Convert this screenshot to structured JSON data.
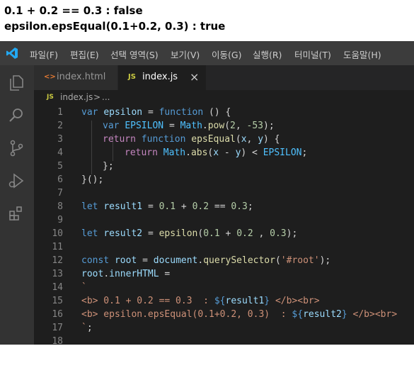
{
  "output": {
    "line1": "0.1 + 0.2 == 0.3 : false",
    "line2": "epsilon.epsEqual(0.1+0.2, 0.3) : true"
  },
  "menu": {
    "items": [
      "파일(F)",
      "편집(E)",
      "선택 영역(S)",
      "보기(V)",
      "이동(G)",
      "실행(R)",
      "터미널(T)",
      "도움말(H)"
    ]
  },
  "tabs": [
    {
      "icon": "<>",
      "label": "index.html",
      "active": false
    },
    {
      "icon": "JS",
      "label": "index.js",
      "active": true,
      "close": "×"
    }
  ],
  "breadcrumb": {
    "icon": "JS",
    "file": "index.js",
    "separator": ">",
    "more": "..."
  },
  "code_lines": [
    {
      "n": "1"
    },
    {
      "n": "2"
    },
    {
      "n": "3"
    },
    {
      "n": "4"
    },
    {
      "n": "5"
    },
    {
      "n": "6"
    },
    {
      "n": "7"
    },
    {
      "n": "8"
    },
    {
      "n": "9"
    },
    {
      "n": "10"
    },
    {
      "n": "11"
    },
    {
      "n": "12"
    },
    {
      "n": "13"
    },
    {
      "n": "14"
    },
    {
      "n": "15"
    },
    {
      "n": "16"
    },
    {
      "n": "17"
    },
    {
      "n": "18"
    }
  ],
  "code_tokens": {
    "l1": [
      "var",
      "epsilon",
      "=",
      "function",
      "() {"
    ],
    "l2": [
      "var",
      "EPSILON",
      "=",
      "Math",
      ".",
      "pow",
      "(",
      "2",
      ", ",
      "-53",
      ");"
    ],
    "l3": [
      "return",
      "function",
      "epsEqual",
      "(",
      "x",
      ", ",
      "y",
      ") {"
    ],
    "l4": [
      "return",
      "Math",
      ".",
      "abs",
      "(",
      "x",
      " - ",
      "y",
      ") < ",
      "EPSILON",
      ";"
    ],
    "l5": [
      "};"
    ],
    "l6": [
      "}();"
    ],
    "l8": [
      "let",
      "result1",
      "=",
      "0.1",
      "+",
      "0.2",
      "==",
      "0.3",
      ";"
    ],
    "l10": [
      "let",
      "result2",
      "=",
      "epsilon",
      "(",
      "0.1",
      " + ",
      "0.2",
      " , ",
      "0.3",
      ");"
    ],
    "l12": [
      "const",
      "root",
      "=",
      "document",
      ".",
      "querySelector",
      "(",
      "'#root'",
      ");"
    ],
    "l13": [
      "root",
      ".",
      "innerHTML",
      " ="
    ],
    "l14": [
      "`"
    ],
    "l15": [
      "<b> 0.1 + 0.2 == 0.3  : ",
      "${",
      "result1",
      "}",
      " </b><br>"
    ],
    "l16": [
      "<b> epsilon.epsEqual(0.1+0.2, 0.3)  : ",
      "${",
      "result2",
      "}",
      " </b><br>"
    ],
    "l17": [
      "`",
      ";"
    ]
  },
  "colors": {
    "keyword": "#569cd6",
    "variable": "#9cdcfe",
    "function": "#dcdcaa",
    "number": "#b5cea8",
    "string": "#ce9178",
    "background": "#1e1e1e"
  }
}
